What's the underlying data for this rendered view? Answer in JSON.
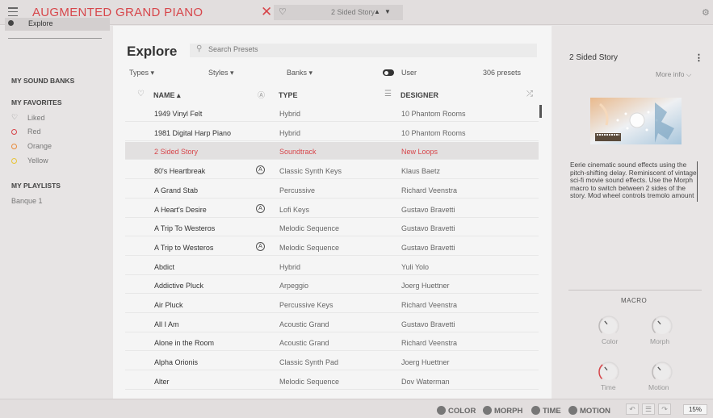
{
  "app": {
    "title": "AUGMENTED GRAND PIANO",
    "current_preset": "2 Sided Story"
  },
  "sidebar": {
    "explore_label": "Explore",
    "my_sound_banks": "MY SOUND BANKS",
    "my_favorites": "MY FAVORITES",
    "favorites": [
      {
        "label": "Liked",
        "icon": "heart-icon",
        "color": "#888888"
      },
      {
        "label": "Red",
        "icon": "ring-icon",
        "color": "#d7464b"
      },
      {
        "label": "Orange",
        "icon": "ring-icon",
        "color": "#e88a3a"
      },
      {
        "label": "Yellow",
        "icon": "ring-icon",
        "color": "#e8c53a"
      }
    ],
    "my_playlists": "MY PLAYLISTS",
    "playlists": [
      "Banque 1"
    ]
  },
  "main": {
    "title": "Explore",
    "search_placeholder": "Search Presets",
    "filters": {
      "types": "Types",
      "styles": "Styles",
      "banks": "Banks",
      "user": "User"
    },
    "preset_count": "306 presets",
    "columns": {
      "name": "NAME",
      "type": "TYPE",
      "designer": "DESIGNER"
    },
    "rows": [
      {
        "name": "1949 Vinyl Felt",
        "badge": false,
        "type": "Hybrid",
        "designer": "10 Phantom Rooms"
      },
      {
        "name": "1981 Digital Harp Piano",
        "badge": false,
        "type": "Hybrid",
        "designer": "10 Phantom Rooms"
      },
      {
        "name": "2 Sided Story",
        "badge": false,
        "type": "Soundtrack",
        "designer": "New Loops",
        "selected": true
      },
      {
        "name": "80's Heartbreak",
        "badge": true,
        "type": "Classic Synth Keys",
        "designer": "Klaus Baetz"
      },
      {
        "name": "A Grand Stab",
        "badge": false,
        "type": "Percussive",
        "designer": "Richard Veenstra"
      },
      {
        "name": "A Heart's Desire",
        "badge": true,
        "type": "Lofi Keys",
        "designer": "Gustavo Bravetti"
      },
      {
        "name": "A Trip To Westeros",
        "badge": false,
        "type": "Melodic Sequence",
        "designer": "Gustavo Bravetti"
      },
      {
        "name": "A Trip to Westeros",
        "badge": true,
        "type": "Melodic Sequence",
        "designer": "Gustavo Bravetti"
      },
      {
        "name": "Abdict",
        "badge": false,
        "type": "Hybrid",
        "designer": "Yuli Yolo"
      },
      {
        "name": "Addictive Pluck",
        "badge": false,
        "type": "Arpeggio",
        "designer": "Joerg Huettner"
      },
      {
        "name": "Air Pluck",
        "badge": false,
        "type": "Percussive Keys",
        "designer": "Richard Veenstra"
      },
      {
        "name": "All I Am",
        "badge": false,
        "type": "Acoustic Grand",
        "designer": "Gustavo Bravetti"
      },
      {
        "name": "Alone in the Room",
        "badge": false,
        "type": "Acoustic Grand",
        "designer": "Richard Veenstra"
      },
      {
        "name": "Alpha Orionis",
        "badge": false,
        "type": "Classic Synth Pad",
        "designer": "Joerg Huettner"
      },
      {
        "name": "Alter",
        "badge": false,
        "type": "Melodic Sequence",
        "designer": "Dov Waterman"
      }
    ]
  },
  "right_panel": {
    "preset_title": "2 Sided Story",
    "more_info": "More info",
    "description": "Eerie cinematic sound effects using the pitch-shifting delay. Reminiscent of vintage sci-fi movie sound effects. Use the Morph macro to switch between 2 sides of the story. Mod wheel controls tremolo amount",
    "macro_title": "MACRO",
    "knobs": [
      {
        "label": "Color",
        "level": 0.35,
        "active": false
      },
      {
        "label": "Morph",
        "level": 0.35,
        "active": false
      },
      {
        "label": "Time",
        "level": 0.35,
        "active": true
      },
      {
        "label": "Motion",
        "level": 0.35,
        "active": false
      }
    ]
  },
  "bottom_bar": {
    "macros": [
      "COLOR",
      "MORPH",
      "TIME",
      "MOTION"
    ],
    "zoom": "15%"
  },
  "colors": {
    "accent": "#d7464b"
  }
}
